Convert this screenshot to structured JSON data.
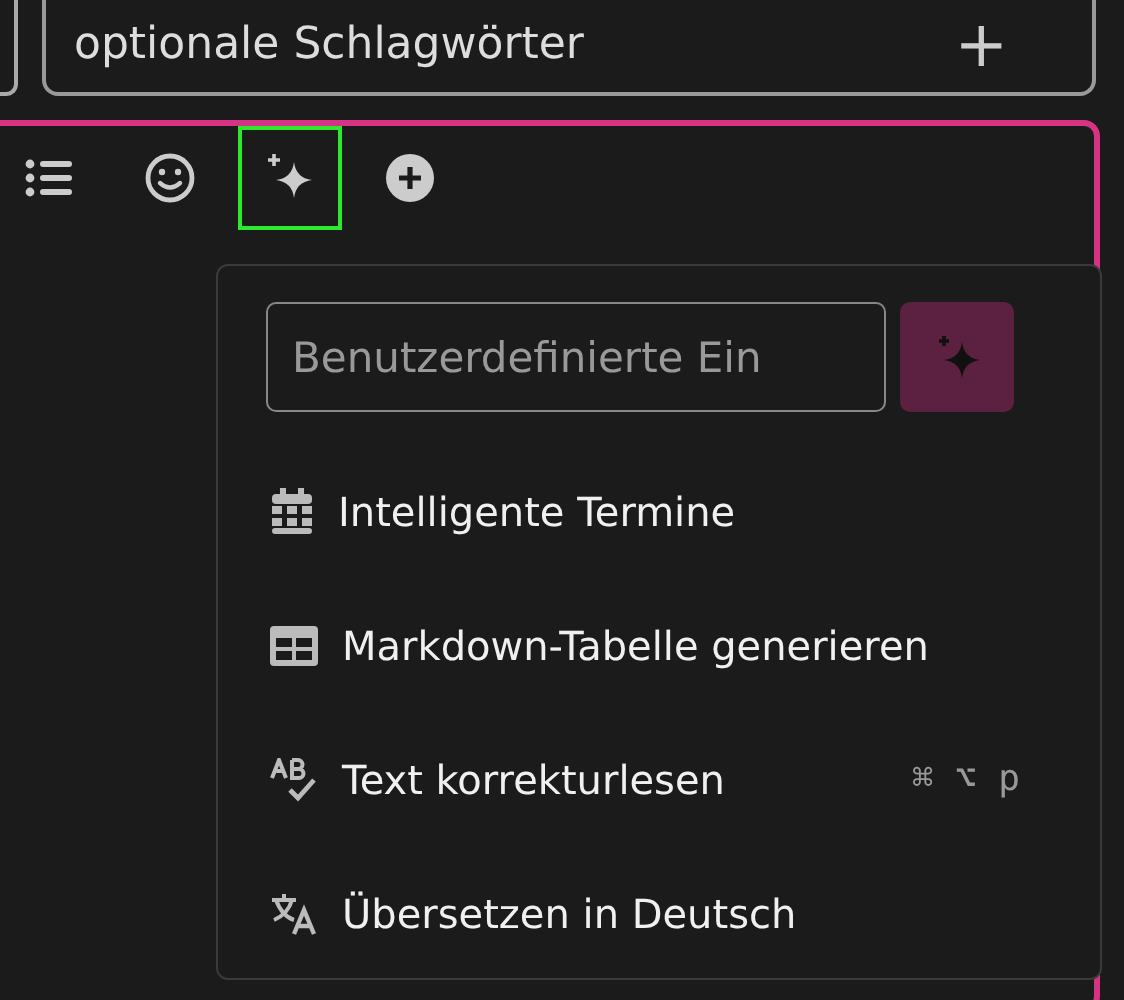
{
  "keywords_field": {
    "placeholder": "optionale Schlagwörter",
    "add_label": "+"
  },
  "toolbar": [
    {
      "kind": "list",
      "selected": false
    },
    {
      "kind": "emoji",
      "selected": false
    },
    {
      "kind": "ai",
      "selected": true
    },
    {
      "kind": "add",
      "selected": false
    }
  ],
  "ai_menu": {
    "prompt_field": {
      "placeholder": "Benutzerdefinierte Ein"
    },
    "items": [
      {
        "kind": "calendar",
        "label": "Intelligente Termine"
      },
      {
        "kind": "table",
        "label": "Markdown-Tabelle generieren"
      },
      {
        "kind": "spellcheck",
        "label": "Text korrekturlesen",
        "shortcut": "⌘ ⌥ p"
      },
      {
        "kind": "translate",
        "label": "Übersetzen in Deutsch"
      }
    ]
  }
}
